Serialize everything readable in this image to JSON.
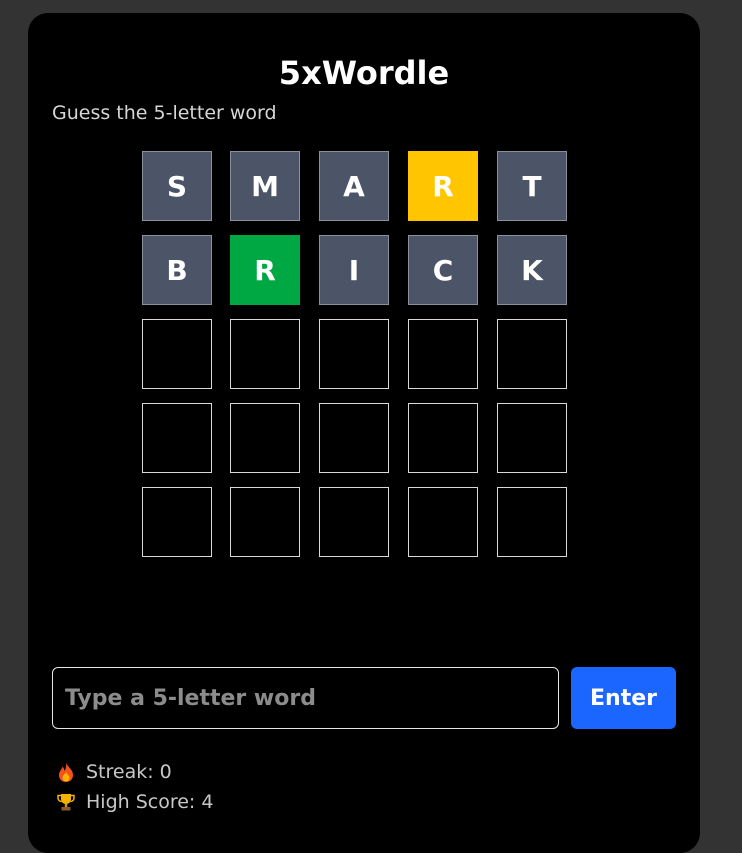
{
  "app": {
    "title": "5xWordle",
    "subtitle": "Guess the 5-letter word"
  },
  "board": {
    "rows": [
      [
        {
          "letter": "S",
          "state": "absent"
        },
        {
          "letter": "M",
          "state": "absent"
        },
        {
          "letter": "A",
          "state": "absent"
        },
        {
          "letter": "R",
          "state": "present"
        },
        {
          "letter": "T",
          "state": "absent"
        }
      ],
      [
        {
          "letter": "B",
          "state": "absent"
        },
        {
          "letter": "R",
          "state": "correct"
        },
        {
          "letter": "I",
          "state": "absent"
        },
        {
          "letter": "C",
          "state": "absent"
        },
        {
          "letter": "K",
          "state": "absent"
        }
      ],
      [
        {
          "letter": "",
          "state": "empty"
        },
        {
          "letter": "",
          "state": "empty"
        },
        {
          "letter": "",
          "state": "empty"
        },
        {
          "letter": "",
          "state": "empty"
        },
        {
          "letter": "",
          "state": "empty"
        }
      ],
      [
        {
          "letter": "",
          "state": "empty"
        },
        {
          "letter": "",
          "state": "empty"
        },
        {
          "letter": "",
          "state": "empty"
        },
        {
          "letter": "",
          "state": "empty"
        },
        {
          "letter": "",
          "state": "empty"
        }
      ],
      [
        {
          "letter": "",
          "state": "empty"
        },
        {
          "letter": "",
          "state": "empty"
        },
        {
          "letter": "",
          "state": "empty"
        },
        {
          "letter": "",
          "state": "empty"
        },
        {
          "letter": "",
          "state": "empty"
        }
      ]
    ]
  },
  "input": {
    "value": "",
    "placeholder": "Type a 5-letter word"
  },
  "enter_button": {
    "label": "Enter"
  },
  "stats": {
    "streak_icon": "fire-icon",
    "streak_label": "Streak: 0",
    "high_score_icon": "trophy-icon",
    "high_score_label": "High Score: 4"
  },
  "colors": {
    "absent": "#4b5567",
    "present": "#ffc600",
    "correct": "#00a844",
    "accent": "#1a66ff"
  }
}
